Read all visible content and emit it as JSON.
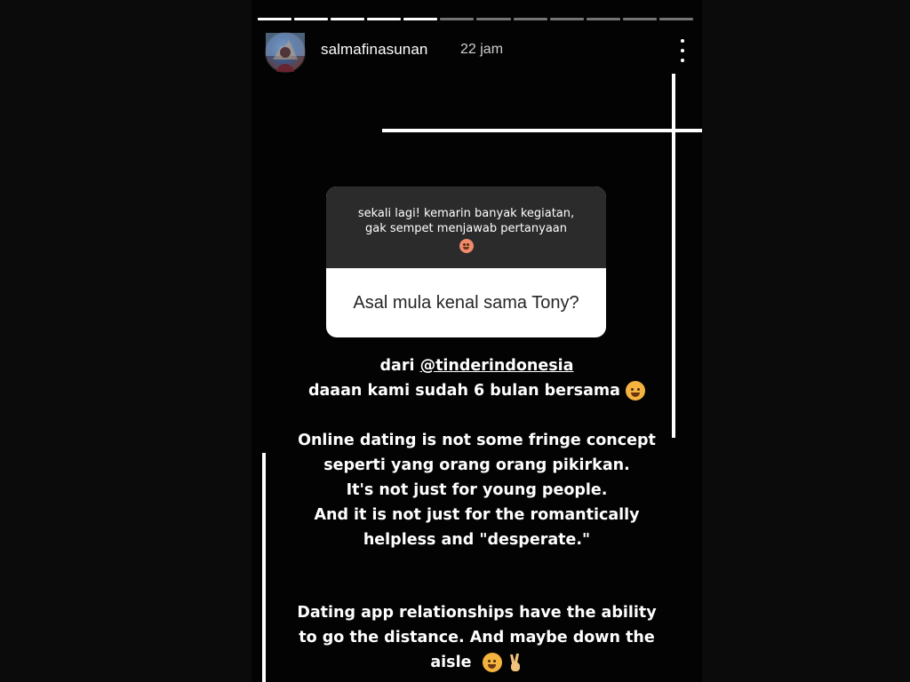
{
  "story": {
    "progress": {
      "segments": 12,
      "viewed": 5
    },
    "header": {
      "username": "salmafinasunan",
      "time": "22 jam",
      "avatar_icon": "avatar-photo",
      "more_icon": "more-vertical-icon"
    },
    "question_sticker": {
      "prompt_line1": "sekali lagi! kemarin banyak kegiatan,",
      "prompt_line2": "gak sempet menjawab pertanyaan",
      "question": "Asal mula kenal sama Tony?"
    },
    "answer": {
      "line1_prefix": "dari ",
      "line1_mention": "@tinderindonesia",
      "line2": "daaan kami sudah 6 bulan bersama",
      "para2": [
        "Online dating is not some fringe concept",
        "seperti yang orang orang pikirkan.",
        "It's not just for young people.",
        "And it is not just for the romantically",
        "helpless and \"desperate.\""
      ],
      "para3_line1": "Dating app relationships have the ability",
      "para3_line2": "to go the distance. And maybe down the",
      "para3_line3": "aisle"
    },
    "colors": {
      "background": "#030303",
      "sticker_top": "#2b2b2b",
      "sticker_bottom": "#ffffff",
      "text": "#ffffff"
    }
  }
}
